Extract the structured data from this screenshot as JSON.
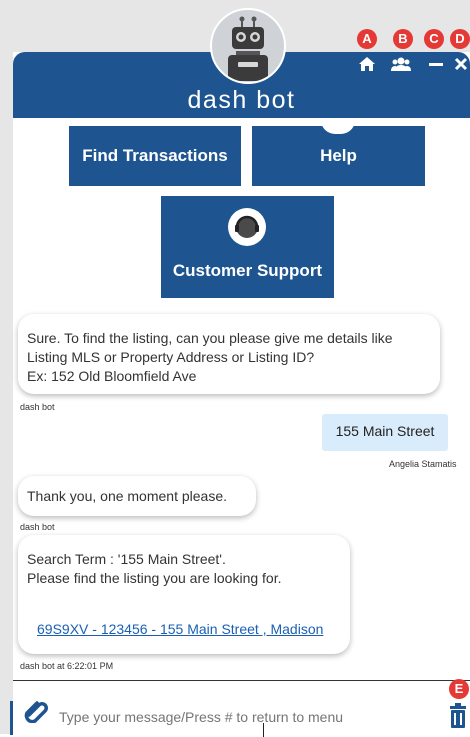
{
  "header": {
    "title": "dash bot",
    "icons": [
      "home-icon",
      "users-icon",
      "minimize-icon",
      "close-icon",
      "trash-icon"
    ],
    "badges": [
      "A",
      "B",
      "C",
      "D",
      "E"
    ]
  },
  "menu": {
    "find_transactions": "Find Transactions",
    "help": "Help",
    "customer_support": "Customer Support"
  },
  "chat": {
    "bot_msg_1": {
      "line1": "Sure. To find the listing, can you please give me details like",
      "line2": "Listing MLS or Property Address or Listing ID?",
      "line3": "Ex: 152 Old Bloomfield Ave",
      "sender": "dash bot"
    },
    "user_msg": {
      "text": "155 Main Street",
      "sender": "Angelia Stamatis"
    },
    "bot_msg_2": {
      "text": "Thank you, one moment please.",
      "sender": "dash bot"
    },
    "bot_msg_3": {
      "line1": "Search Term : '155 Main Street'.",
      "line2": "Please find the listing you are looking for.",
      "link": "69S9XV - 123456 - 155 Main Street , Madison",
      "sender": "dash bot at 6:22:01 PM"
    }
  },
  "input": {
    "placeholder": "Type your message/Press # to return to menu"
  },
  "colors": {
    "brand": "#1e5590",
    "badge": "#e53935",
    "user_bubble": "#d8ecfb",
    "link": "#1a5fb4"
  }
}
